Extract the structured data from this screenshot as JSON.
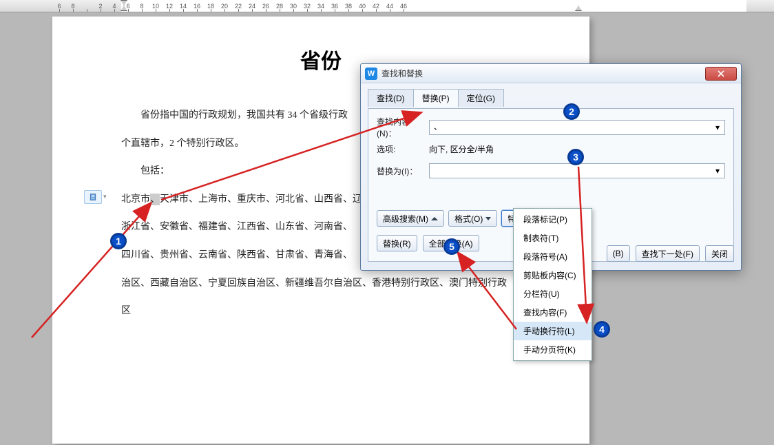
{
  "ruler": {
    "numbers": [
      6,
      8,
      "",
      2,
      4,
      6,
      8,
      10,
      12,
      14,
      16,
      18,
      20,
      22,
      24,
      26,
      28,
      30,
      32,
      34,
      36,
      38,
      40,
      42,
      44,
      46
    ]
  },
  "document": {
    "title": "省份",
    "para1": "省份指中国的行政规划，我国共有 34 个省级行政",
    "para2": "个直辖市，2 个特别行政区。",
    "para3": "包括：",
    "line1_pre": "北京市",
    "line1_sep": "、",
    "line1_rest": "天津市、上海市、重庆市、河北省、山西省、辽",
    "line2": "浙江省、安徽省、福建省、江西省、山东省、河南省、",
    "line3": "四川省、贵州省、云南省、陕西省、甘肃省、青海省、",
    "line4": "治区、西藏自治区、宁夏回族自治区、新疆维吾尔自治区、香港特别行政区、澳门特别行政",
    "line5": "区"
  },
  "dialog": {
    "title": "查找和替换",
    "tabs": {
      "find": "查找(D)",
      "replace": "替换(P)",
      "goto": "定位(G)"
    },
    "find_label": "查找内容(N)：",
    "find_value": "、",
    "options_label": "选项:",
    "options_value": "向下, 区分全/半角",
    "replace_label": "替换为(I)：",
    "replace_value": "",
    "btn_advanced": "高级搜索(M)",
    "btn_format": "格式(O)",
    "btn_special": "特殊格式(E)",
    "btn_replace": "替换(R)",
    "btn_replace_all": "全部替换(A)",
    "btn_some": "(B)",
    "btn_find_next": "查找下一处(F)",
    "btn_close": "关闭"
  },
  "dropdown": {
    "items": [
      "段落标记(P)",
      "制表符(T)",
      "段落符号(A)",
      "剪贴板内容(C)",
      "分栏符(U)",
      "查找内容(F)",
      "手动换行符(L)",
      "手动分页符(K)"
    ],
    "hover_index": 6
  },
  "badges": {
    "b1": "1",
    "b2": "2",
    "b3": "3",
    "b4": "4",
    "b5": "5"
  }
}
